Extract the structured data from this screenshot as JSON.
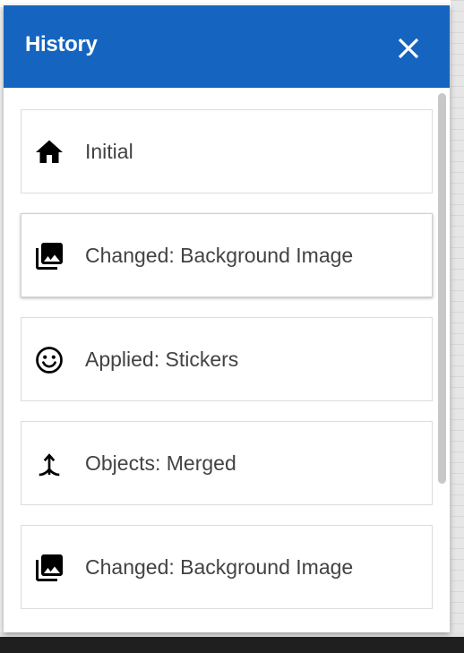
{
  "panel": {
    "title": "History",
    "close_icon": "close-icon",
    "header_color": "#1565c0"
  },
  "history": {
    "items": [
      {
        "label": "Initial",
        "icon": "home-icon"
      },
      {
        "label": "Changed: Background Image",
        "icon": "photo-library-icon",
        "selected": true
      },
      {
        "label": "Applied: Stickers",
        "icon": "smiley-icon"
      },
      {
        "label": "Objects: Merged",
        "icon": "merge-icon"
      },
      {
        "label": "Changed: Background Image",
        "icon": "photo-library-icon"
      }
    ]
  }
}
